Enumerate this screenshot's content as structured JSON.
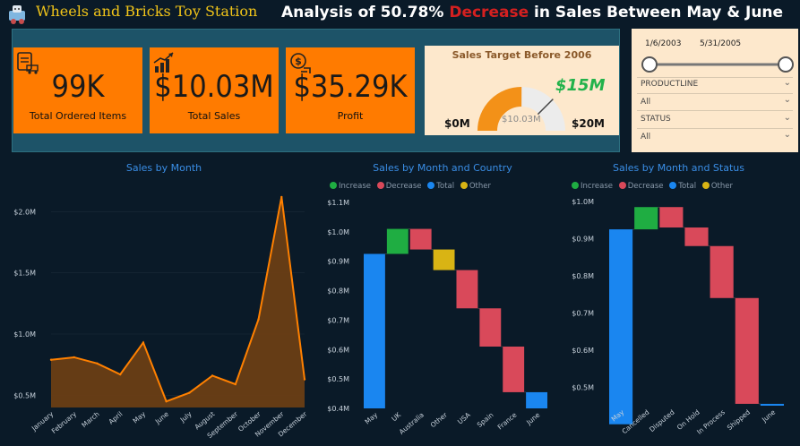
{
  "app": {
    "title": "Wheels and Bricks Toy Station"
  },
  "headline": {
    "prefix": "Analysis of 50.78% ",
    "highlight": "Decrease",
    "suffix": " in Sales Between May & June"
  },
  "kpis": [
    {
      "value": "99K",
      "label": "Total Ordered Items",
      "icon": "clipboard-truck-icon"
    },
    {
      "value": "$10.03M",
      "label": "Total Sales",
      "icon": "bar-growth-icon"
    },
    {
      "value": "$35.29K",
      "label": "Profit",
      "icon": "money-cycle-icon"
    }
  ],
  "gauge": {
    "title": "Sales Target Before 2006",
    "min_label": "$0M",
    "max_label": "$20M",
    "target_label": "$15M",
    "value_label": "$10.03M",
    "min": 0,
    "max": 20,
    "value": 10.03,
    "target": 15
  },
  "slicer": {
    "date_start": "1/6/2003",
    "date_end": "5/31/2005",
    "productline_label": "PRODUCTLINE",
    "productline_value": "All",
    "status_label": "STATUS",
    "status_value": "All"
  },
  "colors": {
    "increase": "#1fad42",
    "decrease": "#d9495a",
    "total": "#1a86f0",
    "other": "#d9b414",
    "area_line": "#ff8000",
    "area_fill": "#6a3e14"
  },
  "legend_labels": {
    "increase": "Increase",
    "decrease": "Decrease",
    "total": "Total",
    "other": "Other"
  },
  "chart_data": [
    {
      "type": "area",
      "title": "Sales by Month",
      "categories": [
        "January",
        "February",
        "March",
        "April",
        "May",
        "June",
        "July",
        "August",
        "September",
        "October",
        "November",
        "December"
      ],
      "values": [
        0.79,
        0.81,
        0.76,
        0.67,
        0.93,
        0.45,
        0.52,
        0.66,
        0.59,
        1.12,
        2.12,
        0.63
      ],
      "yticks": [
        "$0.5M",
        "$1.0M",
        "$1.5M",
        "$2.0M"
      ],
      "ytick_values": [
        0.5,
        1.0,
        1.5,
        2.0
      ],
      "ylim": [
        0.4,
        2.2
      ]
    },
    {
      "type": "waterfall",
      "title": "Sales by Month and Country",
      "categories": [
        "May",
        "UK",
        "Australia",
        "Other",
        "USA",
        "Spain",
        "France",
        "June"
      ],
      "kinds": [
        "total",
        "increase",
        "decrease",
        "other",
        "decrease",
        "decrease",
        "decrease",
        "total"
      ],
      "bars": [
        [
          0.4,
          0.925
        ],
        [
          0.925,
          1.01
        ],
        [
          1.01,
          0.94
        ],
        [
          0.94,
          0.87
        ],
        [
          0.87,
          0.74
        ],
        [
          0.74,
          0.61
        ],
        [
          0.61,
          0.455
        ],
        [
          0.455,
          0.4
        ]
      ],
      "yticks": [
        "$0.4M",
        "$0.5M",
        "$0.6M",
        "$0.7M",
        "$0.8M",
        "$0.9M",
        "$1.0M",
        "$1.1M"
      ],
      "ytick_values": [
        0.4,
        0.5,
        0.6,
        0.7,
        0.8,
        0.9,
        1.0,
        1.1
      ],
      "ylim": [
        0.4,
        1.1
      ]
    },
    {
      "type": "waterfall",
      "title": "Sales by Month and Status",
      "categories": [
        "May",
        "Cancelled",
        "Disputed",
        "On Hold",
        "In Process",
        "Shipped",
        "June"
      ],
      "kinds": [
        "total",
        "increase",
        "decrease",
        "decrease",
        "decrease",
        "decrease",
        "total"
      ],
      "bars": [
        [
          0.4,
          0.925
        ],
        [
          0.925,
          0.985
        ],
        [
          0.985,
          0.93
        ],
        [
          0.93,
          0.88
        ],
        [
          0.88,
          0.74
        ],
        [
          0.74,
          0.455
        ],
        [
          0.455,
          0.45
        ]
      ],
      "yticks": [
        "$0.5M",
        "$0.6M",
        "$0.7M",
        "$0.8M",
        "$0.9M",
        "$1.0M"
      ],
      "ytick_values": [
        0.5,
        0.6,
        0.7,
        0.8,
        0.9,
        1.0
      ],
      "ylim": [
        0.45,
        1.0
      ]
    }
  ]
}
